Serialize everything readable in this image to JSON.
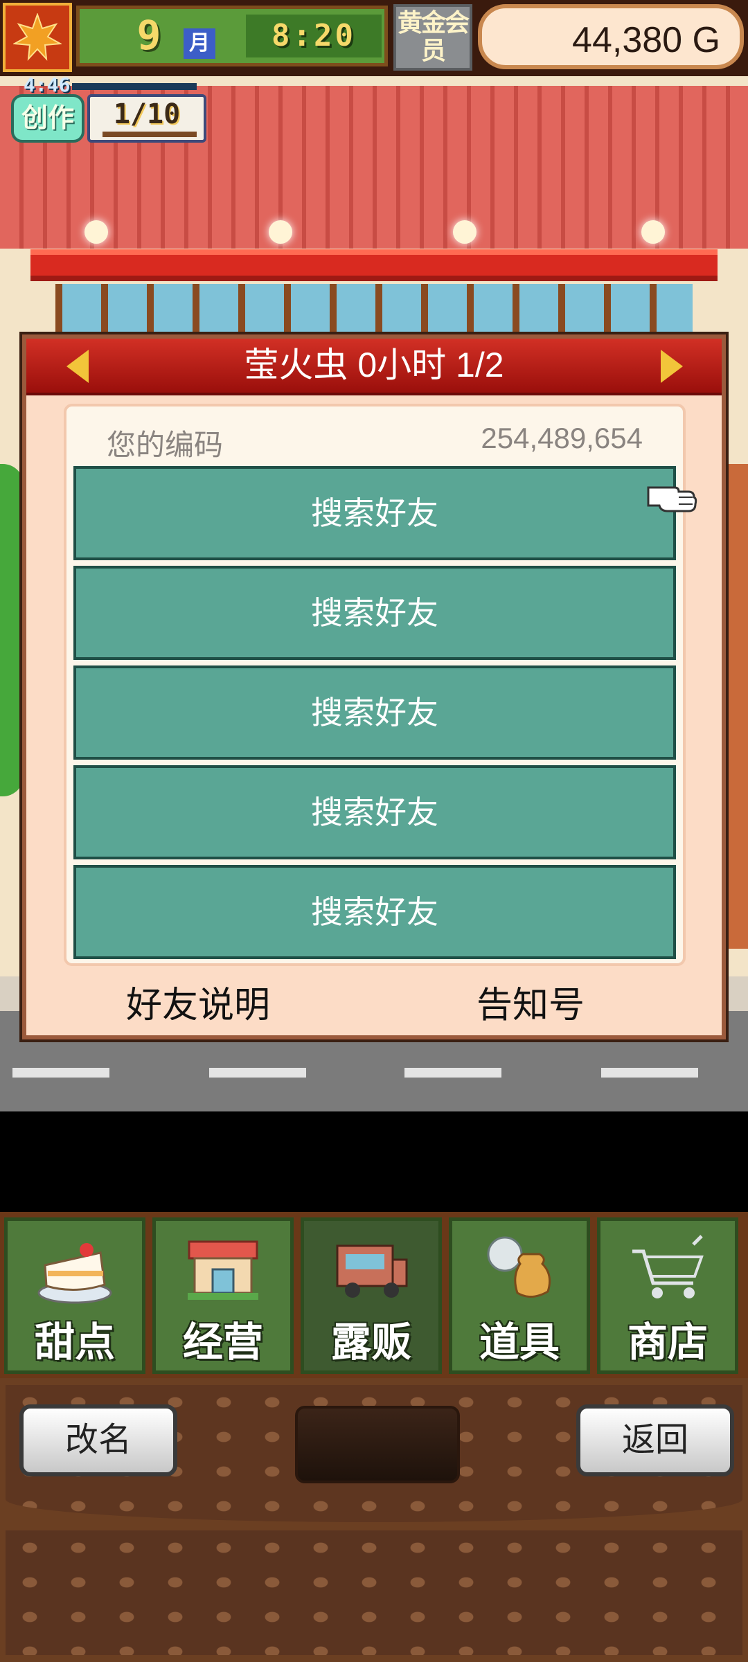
{
  "status_bar": {
    "month_number": "9",
    "month_label": "月",
    "time": "8:20",
    "gold_member": "黄金会员",
    "money": "44,380 G",
    "timer": "4:46",
    "create_label": "创作",
    "create_count": "1/10"
  },
  "dialog": {
    "title": "莹火虫  0小时 1/2",
    "code_label": "您的编码",
    "code_value": "254,489,654",
    "friend_buttons": [
      "搜索好友",
      "搜索好友",
      "搜索好友",
      "搜索好友",
      "搜索好友"
    ],
    "explain_label": "好友说明",
    "notice_label": "告知号"
  },
  "menu": {
    "tabs": [
      {
        "label": "甜点",
        "icon": "cake-icon"
      },
      {
        "label": "经营",
        "icon": "shop-icon"
      },
      {
        "label": "露贩",
        "icon": "food-truck-icon"
      },
      {
        "label": "道具",
        "icon": "item-bag-icon"
      },
      {
        "label": "商店",
        "icon": "shopping-cart-icon"
      }
    ],
    "active_tab": "露贩"
  },
  "bottom_panel": {
    "rename_label": "改名",
    "back_label": "返回"
  },
  "colors": {
    "dialog_header": "#c0201a",
    "friend_button": "#5aa695",
    "menu_tab": "#4f7a3b"
  }
}
